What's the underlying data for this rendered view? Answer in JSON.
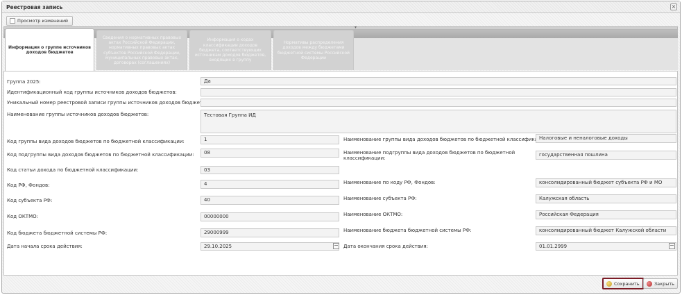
{
  "window": {
    "title": "Реестровая запись",
    "close_glyph": "×"
  },
  "toolbar": {
    "history_button": "Просмотр изменений"
  },
  "tabs": [
    {
      "label": "Информация о группе источников доходов бюджетов",
      "active": true
    },
    {
      "label": "Сведения о нормативных правовых актах Российской Федерации, нормативных правовых актах субъектов Российской Федерации, муниципальных правовых актах, договорах (соглашениях)",
      "active": false
    },
    {
      "label": "Информация о кодах классификации доходов бюджета, соответствующих источникам доходов бюджетов, входящих в группу",
      "active": false
    },
    {
      "label": "Нормативы распределения доходов между бюджетами бюджетной системы Российской Федерации",
      "active": false
    }
  ],
  "form": {
    "group2025": {
      "label": "Группа 2025:",
      "value": "Да"
    },
    "ident_code": {
      "label": "Идентификационный код группы источников доходов бюджетов:",
      "value": ""
    },
    "unique_number": {
      "label": "Уникальный номер реестровой записи группы источников доходов бюджета:",
      "value": ""
    },
    "group_name": {
      "label": "Наименование группы источников доходов бюджетов:",
      "value": "Тестовая Группа ИД"
    },
    "group_kind_code": {
      "label": "Код группы вида доходов бюджетов по бюджетной классификации:",
      "value": "1"
    },
    "group_kind_name": {
      "label": "Наименование группы вида доходов бюджетов по бюджетной классификации:",
      "value": "Налоговые и неналоговые доходы"
    },
    "subgroup_code": {
      "label": "Код подгруппы вида доходов бюджетов по бюджетной классификации:",
      "value": "08"
    },
    "subgroup_name": {
      "label": "Наименование подгруппы вида доходов бюджетов по бюджетной классификации:",
      "value": "государственная пошлина"
    },
    "article_code": {
      "label": "Код статьи дохода по бюджетной классификации:",
      "value": "03"
    },
    "rf_code": {
      "label": "Код РФ, Фондов:",
      "value": "4"
    },
    "rf_name": {
      "label": "Наименование по коду РФ, Фондов:",
      "value": "консолидированный бюджет субъекта РФ и МО"
    },
    "subject_code": {
      "label": "Код субъекта РФ:",
      "value": "40"
    },
    "subject_name": {
      "label": "Наименование субъекта РФ:",
      "value": "Калужская область"
    },
    "oktmo_code": {
      "label": "Код ОКТМО:",
      "value": "00000000"
    },
    "oktmo_name": {
      "label": "Наименование ОКТМО:",
      "value": "Российская Федерация"
    },
    "budget_code": {
      "label": "Код бюджета бюджетной системы РФ:",
      "value": "29000999"
    },
    "budget_name": {
      "label": "Наименование бюджета бюджетной системы РФ:",
      "value": "консолидированный бюджет Калужской области"
    },
    "start_date": {
      "label": "Дата начала срока действия:",
      "value": "29.10.2025"
    },
    "end_date": {
      "label": "Дата окончания срока действия:",
      "value": "01.01.2999"
    }
  },
  "footer": {
    "save_label": "Сохранить",
    "close_label": "Закрыть"
  },
  "icons": {
    "save": "save-icon",
    "close": "close-icon",
    "calendar": "calendar-icon",
    "history": "history-icon"
  }
}
